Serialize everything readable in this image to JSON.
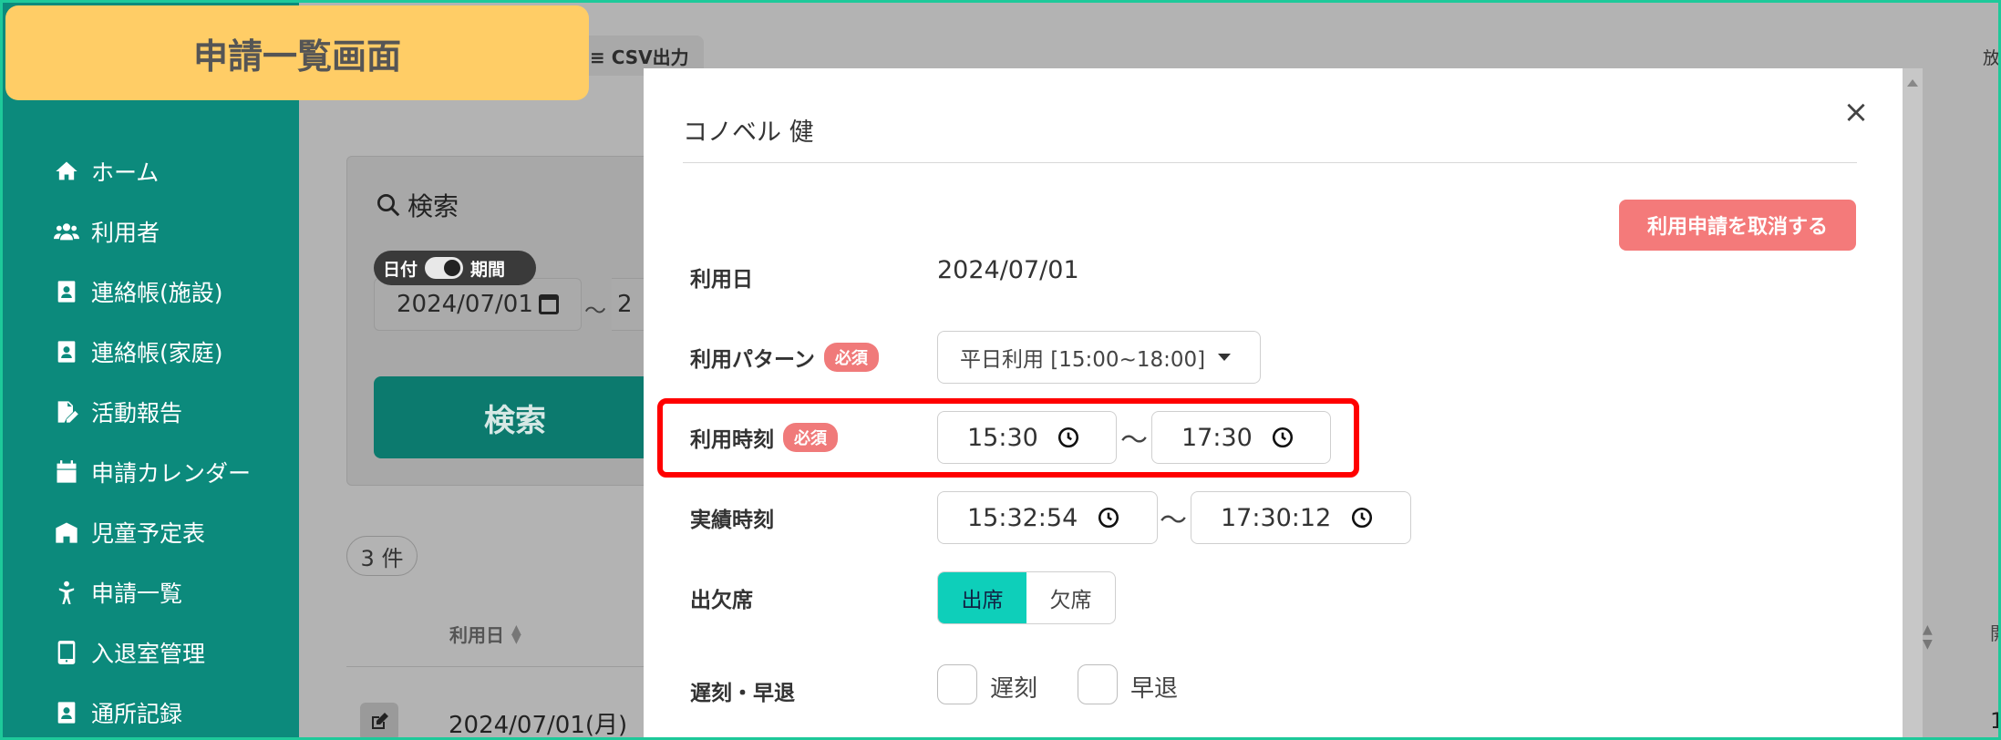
{
  "banner": {
    "title": "申請一覧画面"
  },
  "sidebar": {
    "items": [
      {
        "label": "ホーム",
        "icon": "home-icon"
      },
      {
        "label": "利用者",
        "icon": "users-icon"
      },
      {
        "label": "連絡帳(施設)",
        "icon": "contact-book-icon"
      },
      {
        "label": "連絡帳(家庭)",
        "icon": "contact-book-icon"
      },
      {
        "label": "活動報告",
        "icon": "report-icon"
      },
      {
        "label": "申請カレンダー",
        "icon": "calendar-icon"
      },
      {
        "label": "児童予定表",
        "icon": "schedule-icon"
      },
      {
        "label": "申請一覧",
        "icon": "child-icon"
      },
      {
        "label": "入退室管理",
        "icon": "tablet-icon"
      },
      {
        "label": "通所記録",
        "icon": "contact-book-icon"
      }
    ]
  },
  "background": {
    "csv_button": "≡ CSV出力",
    "right_edge_text": "放",
    "search_title": "検索",
    "toggle_left": "日付",
    "toggle_right": "期間",
    "date_from": "2024/07/01",
    "tilde": "～",
    "date_to_fragment": "2",
    "search_button": "検索",
    "count": "3 件",
    "column_date": "利用日",
    "row_date": "2024/07/01(月)",
    "right_col_fragment": "開",
    "right_row_fragment": "1"
  },
  "modal": {
    "title": "コノベル 健",
    "close_label": "×",
    "cancel_button": "利用申請を取消する",
    "required_badge": "必須",
    "usage_date_label": "利用日",
    "usage_date_value": "2024/07/01",
    "pattern_label": "利用パターン",
    "pattern_value": "平日利用 [15:00~18:00]",
    "usage_time_label": "利用時刻",
    "usage_time_from": "15:30",
    "usage_time_to": "17:30",
    "actual_time_label": "実績時刻",
    "actual_time_from": "15:32:54",
    "actual_time_to": "17:30:12",
    "tilde": "～",
    "attendance_label": "出欠席",
    "attendance_options": [
      "出席",
      "欠席"
    ],
    "attendance_selected": "出席",
    "late_label": "遅刻・早退",
    "late_options": [
      "遅刻",
      "早退"
    ]
  },
  "colors": {
    "sidebar": "#0c8a7c",
    "banner": "#ffcd66",
    "cancel": "#f47a7a",
    "selected_segment": "#0ecfba",
    "highlight": "#ff0000"
  }
}
